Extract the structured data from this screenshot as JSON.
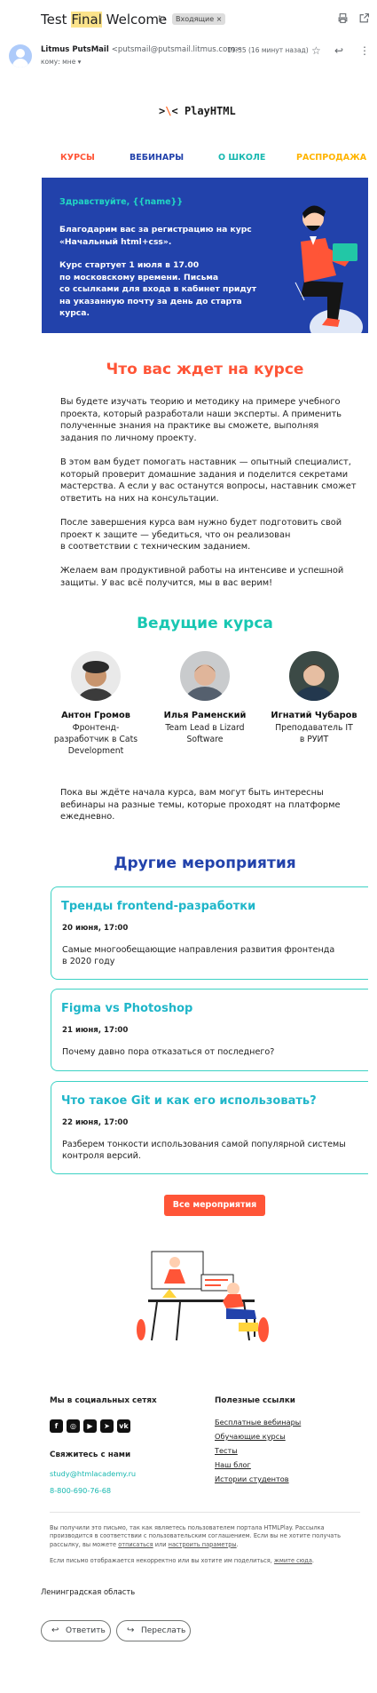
{
  "gmail": {
    "subject_pre": "Test ",
    "subject_highlight": "Final",
    "subject_post": " Welcome",
    "label": "Входящие ×",
    "sender_name": "Litmus PutsMail",
    "sender_email": "<putsmail@putsmail.litmus.com>",
    "to": "кому: мне ▾",
    "time": "19:35 (16 минут назад)",
    "reply_label": "Ответить",
    "forward_label": "Переслать"
  },
  "email": {
    "logo": "PlayHTML",
    "nav": [
      "КУРСЫ",
      "ВЕБИНАРЫ",
      "О ШКОЛЕ",
      "РАСПРОДАЖА"
    ],
    "colors": {
      "nav": [
        "#ff5537",
        "#2242ab",
        "#18b8b0",
        "#ffb400"
      ],
      "hero_bg": "#2242ab",
      "accent_orange": "#ff5537",
      "accent_teal": "#18b8b0",
      "accent_blue": "#2242ab"
    },
    "hero": {
      "greeting": "Здравствуйте, {{name}}",
      "p1": "Благодарим вас за регистрацию на курс\n«Начальный html+css».",
      "p2": "Курс стартует 1 июля в 17.00\nпо московскому времени. Письма\nсо ссылками для входа в кабинет придут\nна указанную почту за день до старта\nкурса."
    },
    "course": {
      "title": "Что вас ждет на курсе",
      "p1": "Вы будете изучать теорию и методику на примере учебного\nпроекта, который разработали наши эксперты. А применить\nполученные знания на практике вы сможете, выполняя\nзадания по личному проекту.",
      "p2": "В этом вам будет помогать наставник — опытный специалист,\nкоторый проверит домашние задания и поделится секретами\nмастерства. А если у вас останутся вопросы, наставник сможет\nответить на них на консультации.",
      "p3": "После завершения курса вам нужно будет подготовить свой\nпроект к защите — убедиться, что он реализован\nв соответствии с техническим заданием.",
      "p4": "Желаем вам продуктивной работы на интенсиве и успешной\nзащиты. У вас всё получится, мы в вас верим!"
    },
    "mentors_title": "Ведущие курса",
    "mentors": [
      {
        "name": "Антон Громов",
        "role": "Фронтенд-\nразработчик в Cats\nDevelopment"
      },
      {
        "name": "Илья Раменский",
        "role": "Team Lead в Lizard\nSoftware"
      },
      {
        "name": "Игнатий Чубаров",
        "role": "Преподаватель IT\nв РУИТ"
      }
    ],
    "webinars_intro": "Пока вы ждёте начала курса, вам могут быть интересны\nвебинары на разные темы, которые проходят на платформе\nежедневно.",
    "events_title": "Другие мероприятия",
    "events": [
      {
        "title": "Тренды frontend-разработки",
        "date": "20 июня, 17:00",
        "text": "Самые многообещающие направления развития фронтенда\nв 2020 году"
      },
      {
        "title": "Figma vs Photoshop",
        "date": "21 июня, 17:00",
        "text": "Почему давно пора отказаться от последнего?"
      },
      {
        "title": "Что такое Git и как его использовать?",
        "date": "22 июня, 17:00",
        "text": "Разберем тонкости использования самой популярной системы\nконтроля версий."
      }
    ],
    "cta": "Все мероприятия",
    "footer": {
      "social_title": "Мы в социальных сетях",
      "social_icons": [
        "facebook-icon",
        "instagram-icon",
        "youtube-icon",
        "telegram-icon",
        "vk-icon"
      ],
      "contact_title": "Свяжитесь с нами",
      "email": "study@htmlacademy.ru",
      "phone": "8-800-690-76-68",
      "links_title": "Полезные ссылки",
      "links": [
        "Бесплатные вебинары",
        "Обучающие курсы",
        "Тесты",
        "Наш блог",
        "Истории студентов"
      ],
      "legal_1": "Вы получили это письмо, так как являетесь пользователем портала HTMLPlay. Рассылка производится в соответствии с пользовательским соглашением. Если вы не хотите получать рассылку, вы можете",
      "legal_unsub": "отписаться",
      "legal_or": " или ",
      "legal_settings": "настроить параметры",
      "legal_2": "Если письмо отображается некорректно или вы хотите им поделиться,",
      "legal_web": "жмите сюда"
    },
    "address": "Ленинградская область"
  }
}
